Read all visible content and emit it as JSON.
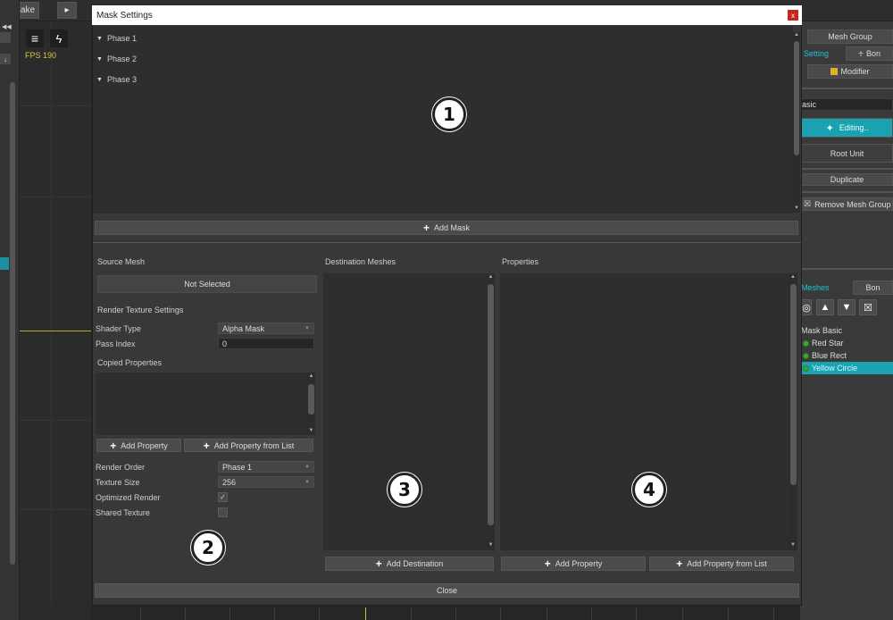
{
  "toolbar": {
    "bake_label": "Bake"
  },
  "viewport": {
    "fps_label": "FPS 190"
  },
  "right_panel": {
    "mesh_group_label": "Mesh Group",
    "tab_setting": "Setting",
    "tab_bone": "Bon",
    "modifier_label": "Modifier",
    "name_field": "asic",
    "editing_label": "Editing..",
    "root_unit_label": "Root Unit",
    "duplicate_label": "Duplicate",
    "remove_label": "Remove Mesh Group",
    "tab_meshes": "Meshes",
    "tab_bone2": "Bon",
    "mesh_list": [
      {
        "label": "Mask Basic"
      },
      {
        "label": "Red Star"
      },
      {
        "label": "Blue Rect"
      },
      {
        "label": "Yellow Circle"
      }
    ]
  },
  "dialog": {
    "title": "Mask Settings",
    "close_x": "x",
    "phases": [
      "Phase 1",
      "Phase 2",
      "Phase 3"
    ],
    "add_mask_label": "Add Mask",
    "source_mesh": {
      "header": "Source Mesh",
      "value": "Not Selected"
    },
    "render_texture_settings": "Render Texture Settings",
    "shader_type_label": "Shader Type",
    "shader_type_value": "Alpha Mask",
    "pass_index_label": "Pass Index",
    "pass_index_value": "0",
    "copied_properties_label": "Copied Properties",
    "add_property_label": "Add Property",
    "add_property_from_list_label": "Add Property from List",
    "render_order_label": "Render Order",
    "render_order_value": "Phase 1",
    "texture_size_label": "Texture Size",
    "texture_size_value": "256",
    "optimized_render_label": "Optimized Render",
    "optimized_render_checked": true,
    "shared_texture_label": "Shared Texture",
    "shared_texture_checked": false,
    "destination_meshes_header": "Destination Meshes",
    "add_destination_label": "Add Destination",
    "properties_header": "Properties",
    "properties_add_property_label": "Add Property",
    "properties_add_from_list_label": "Add Property from List",
    "close_label": "Close"
  },
  "callouts": [
    "1",
    "2",
    "3",
    "4"
  ]
}
